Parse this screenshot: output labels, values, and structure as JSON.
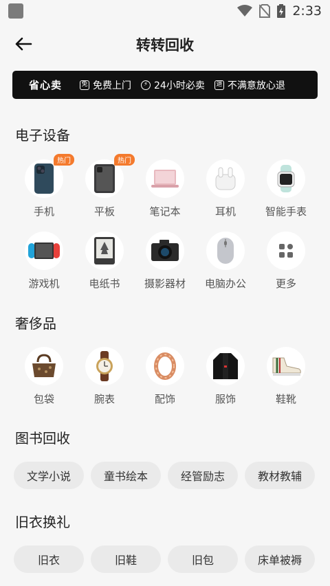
{
  "status": {
    "time": "2:33"
  },
  "header": {
    "title": "转转回收"
  },
  "banner": {
    "brand": "省心卖",
    "items": [
      {
        "icon": "免",
        "label": "免费上门"
      },
      {
        "icon": "⚡",
        "label": "24小时必卖"
      },
      {
        "icon": "退",
        "label": "不满意放心退"
      }
    ]
  },
  "electronics": {
    "title": "电子设备",
    "hot_label": "热门",
    "items": [
      {
        "label": "手机"
      },
      {
        "label": "平板"
      },
      {
        "label": "笔记本"
      },
      {
        "label": "耳机"
      },
      {
        "label": "智能手表"
      },
      {
        "label": "游戏机"
      },
      {
        "label": "电纸书"
      },
      {
        "label": "摄影器材"
      },
      {
        "label": "电脑办公"
      },
      {
        "label": "更多"
      }
    ]
  },
  "luxury": {
    "title": "奢侈品",
    "items": [
      {
        "label": "包袋"
      },
      {
        "label": "腕表"
      },
      {
        "label": "配饰"
      },
      {
        "label": "服饰"
      },
      {
        "label": "鞋靴"
      }
    ]
  },
  "books": {
    "title": "图书回收",
    "items": [
      "文学小说",
      "童书绘本",
      "经管励志",
      "教材教辅"
    ]
  },
  "clothes": {
    "title": "旧衣换礼",
    "items": [
      "旧衣",
      "旧鞋",
      "旧包",
      "床单被褥"
    ]
  },
  "colors": {
    "accent": "#f47a2d",
    "banner_bg": "#111111"
  }
}
